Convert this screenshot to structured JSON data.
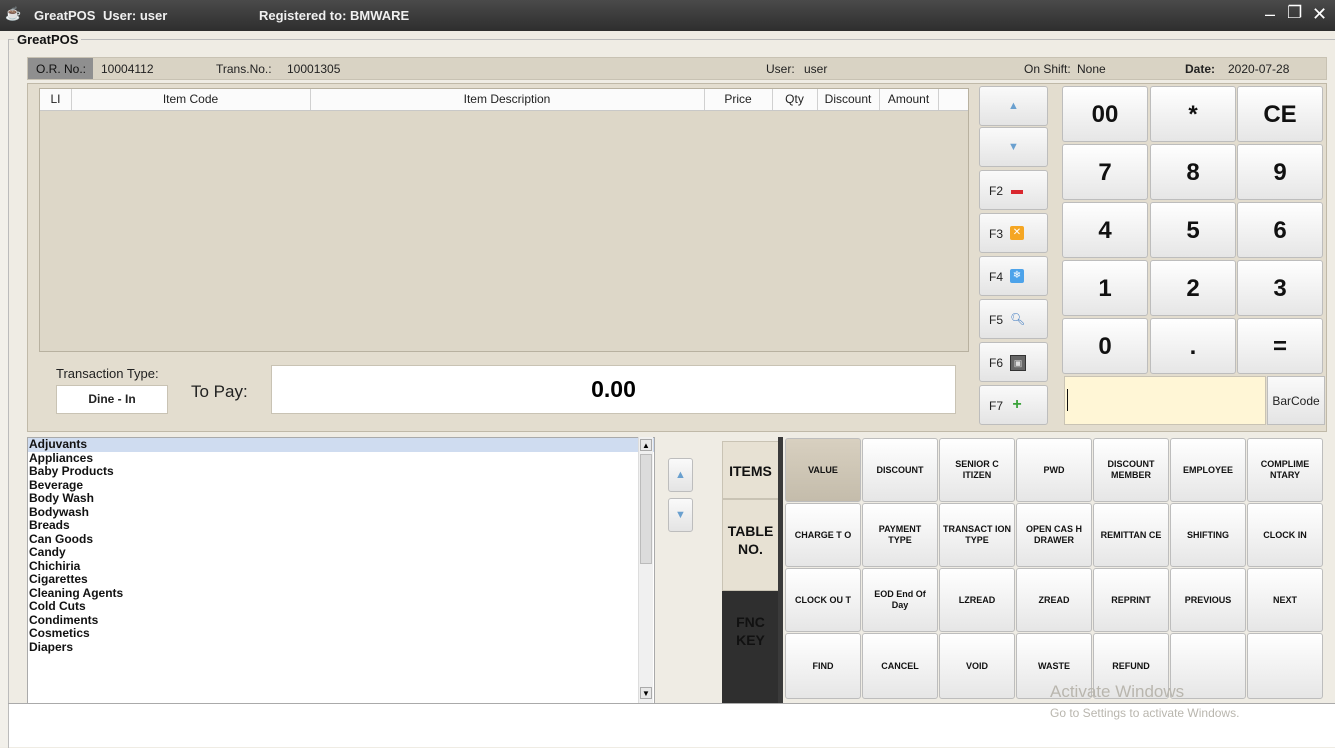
{
  "window": {
    "app_title": "GreatPOS",
    "user_text": "User: user",
    "registered_text": "Registered to: BMWARE",
    "frame_label": "GreatPOS"
  },
  "infobar": {
    "or_label": "O.R. No.:",
    "or_value": "10004112",
    "trans_label": "Trans.No.:",
    "trans_value": "10001305",
    "user_label": "User:",
    "user_value": "user",
    "shift_label": "On Shift:",
    "shift_value": "None",
    "date_label": "Date:",
    "date_value": "2020-07-28"
  },
  "grid": {
    "columns": [
      "LI",
      "Item Code",
      "Item Description",
      "Price",
      "Qty",
      "Discount",
      "Amount"
    ]
  },
  "transaction": {
    "type_label": "Transaction Type:",
    "type_value": "Dine - In",
    "to_pay_label": "To Pay:",
    "to_pay_value": "0.00"
  },
  "fkeys": [
    {
      "label": "F2",
      "icon": "minus-icon"
    },
    {
      "label": "F3",
      "icon": "cancel-icon"
    },
    {
      "label": "F4",
      "icon": "snowflake-icon"
    },
    {
      "label": "F5",
      "icon": "search-icon"
    },
    {
      "label": "F6",
      "icon": "image-icon"
    },
    {
      "label": "F7",
      "icon": "plus-icon"
    }
  ],
  "numpad": [
    "00",
    "*",
    "CE",
    "7",
    "8",
    "9",
    "4",
    "5",
    "6",
    "1",
    "2",
    "3",
    "0",
    ".",
    "="
  ],
  "barcode": {
    "input_value": "",
    "button_label": "BarCode"
  },
  "categories": [
    "Adjuvants",
    "Appliances",
    "Baby Products",
    "Beverage",
    "Body Wash",
    "Bodywash",
    "Breads",
    "Can Goods",
    "Candy",
    "Chichiria",
    "Cigarettes",
    "Cleaning Agents",
    "Cold Cuts",
    "Condiments",
    "Cosmetics",
    "Diapers"
  ],
  "tabs": {
    "items": "ITEMS",
    "table_line1": "TABLE",
    "table_line2": "NO.",
    "fnc_line1": "FNC",
    "fnc_line2": "KEY"
  },
  "function_keys": [
    [
      "VALUE",
      "DISCOUNT",
      "SENIOR C ITIZEN",
      "PWD",
      "DISCOUNT MEMBER",
      "EMPLOYEE",
      "COMPLIME NTARY"
    ],
    [
      "CHARGE T O",
      "PAYMENT TYPE",
      "TRANSACT ION TYPE",
      "OPEN CAS H DRAWER",
      "REMITTAN CE",
      "SHIFTING",
      "CLOCK IN"
    ],
    [
      "CLOCK OU T",
      "EOD End Of Day",
      "LZREAD",
      "ZREAD",
      "REPRINT",
      "PREVIOUS",
      "NEXT"
    ],
    [
      "FIND",
      "CANCEL",
      "VOID",
      "WASTE",
      "REFUND",
      "",
      ""
    ]
  ],
  "watermark": {
    "line1": "Activate Windows",
    "line2": "Go to Settings to activate Windows."
  },
  "colors": {
    "titlebar": "#2e2e2e",
    "panel": "#e3ddcf",
    "accent": "#6aa0cf",
    "barcode_bg": "#fff6d6",
    "fnc_tab": "#2f2f2f"
  }
}
